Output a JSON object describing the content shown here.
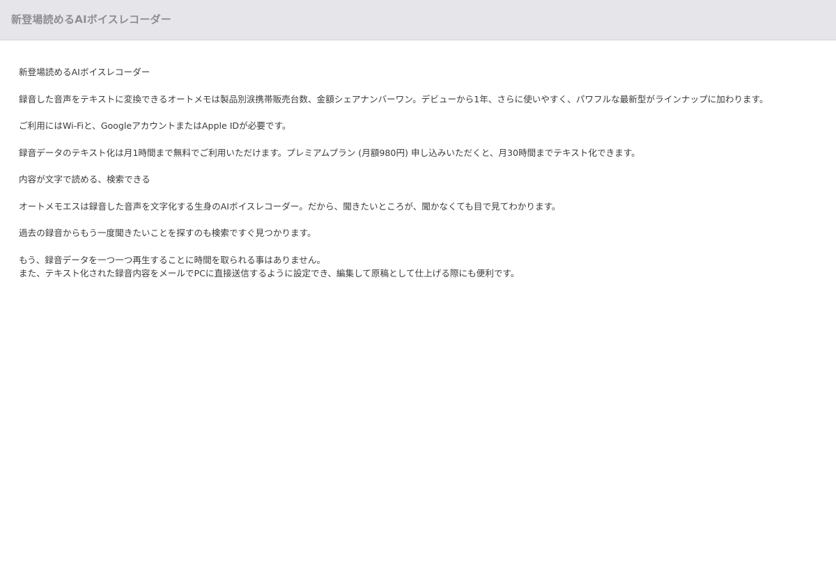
{
  "header": {
    "title": "新登場読めるAIボイスレコーダー"
  },
  "content": {
    "paragraphs": [
      {
        "lines": [
          "新登場読めるAIボイスレコーダー"
        ]
      },
      {
        "lines": [
          "録音した音声をテキストに変換できるオートメモは製品別涙携帯販売台数、金額シェアナンバーワン。デビューから1年、さらに使いやすく、パワフルな最新型がラインナップに加わります。"
        ]
      },
      {
        "lines": [
          "ご利用にはWi-Fiと、GoogleアカウントまたはApple IDが必要です。"
        ]
      },
      {
        "lines": [
          "録音データのテキスト化は月1時間まで無料でご利用いただけます。プレミアムプラン (月額980円) 申し込みいただくと、月30時間までテキスト化できます。"
        ]
      },
      {
        "lines": [
          "内容が文字で読める、検索できる"
        ]
      },
      {
        "lines": [
          "オートメモエスは録音した音声を文字化する生身のAIボイスレコーダー。だから、聞きたいところが、聞かなくても目で見てわかります。"
        ]
      },
      {
        "lines": [
          "過去の録音からもう一度聞きたいことを探すのも検索ですぐ見つかります。"
        ]
      },
      {
        "lines": [
          "もう、録音データを一つ一つ再生することに時間を取られる事はありません。",
          "また、テキスト化された録音内容をメールでPCに直接送信するように設定でき、編集して原稿として仕上げる際にも便利です。"
        ]
      }
    ]
  }
}
